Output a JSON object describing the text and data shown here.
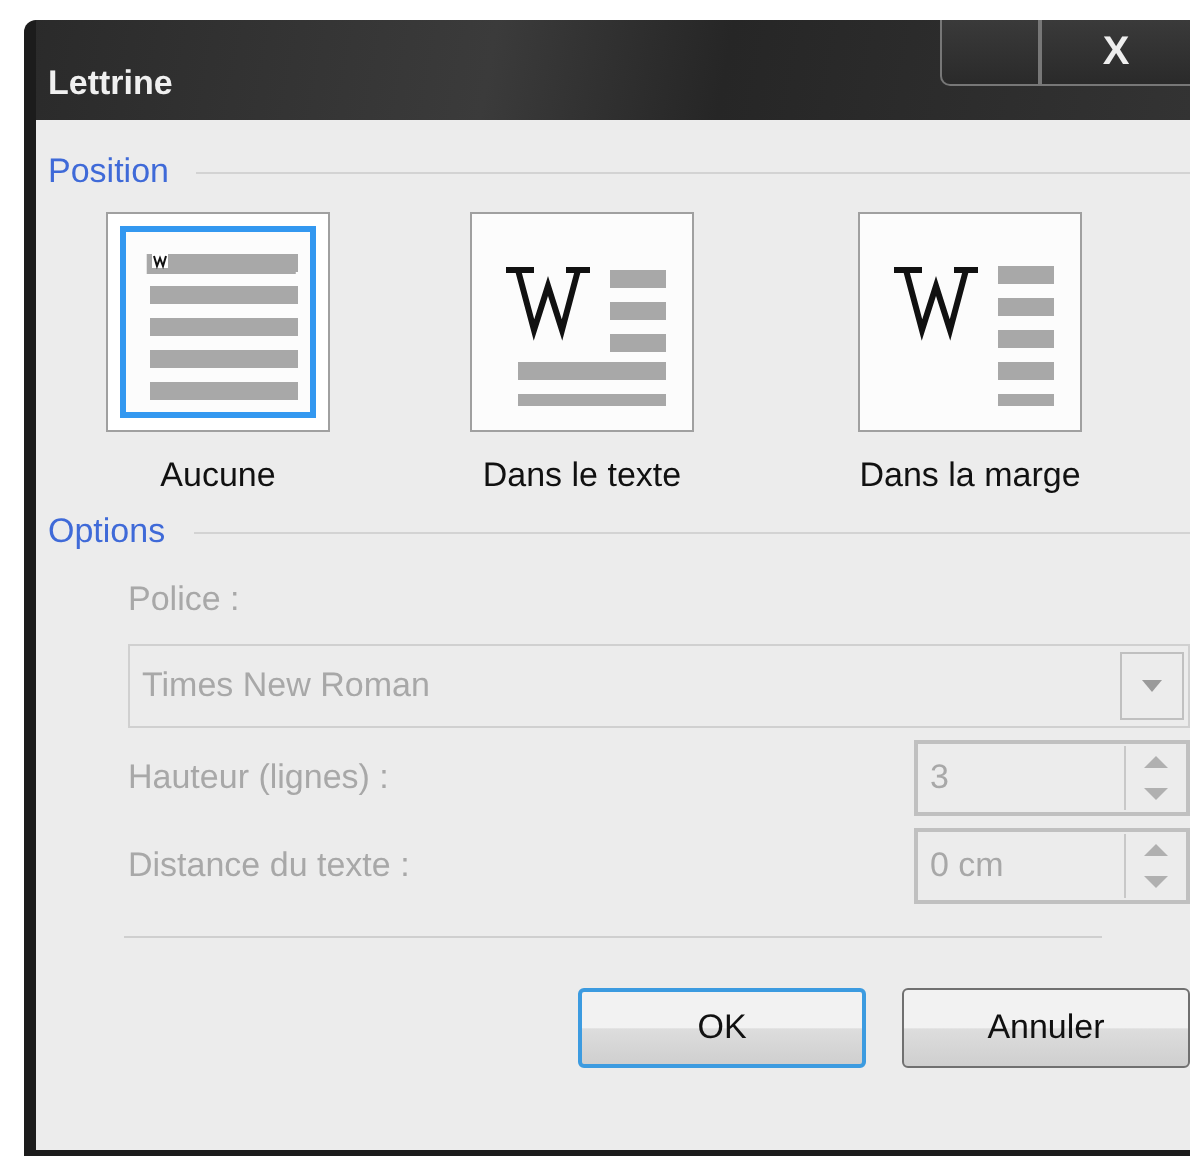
{
  "window": {
    "title": "Lettrine",
    "close_label": "X"
  },
  "position": {
    "heading": "Position",
    "choices": [
      {
        "kind": "none",
        "label": "Aucune",
        "selected": true
      },
      {
        "kind": "dropped",
        "label": "Dans le texte",
        "selected": false
      },
      {
        "kind": "margin",
        "label": "Dans la marge",
        "selected": false
      }
    ]
  },
  "options": {
    "heading": "Options",
    "font_label": "Police :",
    "font_value": "Times New Roman",
    "font_disabled": true,
    "height_label": "Hauteur (lignes) :",
    "height_value": "3",
    "height_disabled": true,
    "distance_label": "Distance du texte :",
    "distance_value": "0 cm",
    "distance_disabled": true
  },
  "buttons": [
    {
      "label": "OK",
      "default": true
    },
    {
      "label": "Annuler",
      "default": false
    }
  ]
}
